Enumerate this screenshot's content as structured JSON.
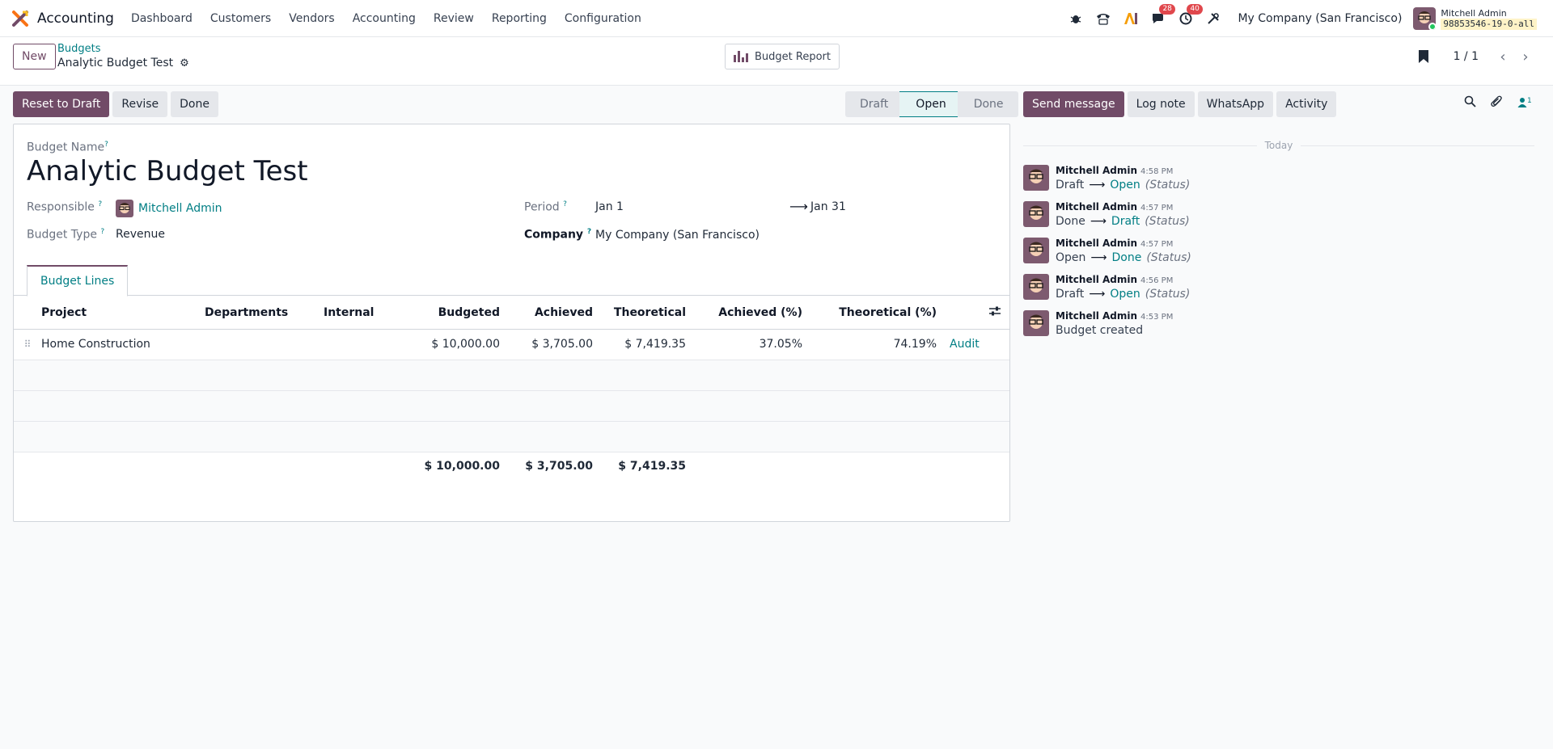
{
  "navbar": {
    "app_name": "Accounting",
    "menu": [
      "Dashboard",
      "Customers",
      "Vendors",
      "Accounting",
      "Review",
      "Reporting",
      "Configuration"
    ],
    "chat_badge": "28",
    "activity_badge": "40",
    "company": "My Company (San Francisco)",
    "user_name": "Mitchell Admin",
    "db_name": "98853546-19-0-all"
  },
  "control": {
    "new_label": "New",
    "breadcrumb_parent": "Budgets",
    "breadcrumb_current": "Analytic Budget Test",
    "report_label": "Budget Report",
    "pager_value": "1 / 1"
  },
  "statusbar": {
    "buttons": [
      "Reset to Draft",
      "Revise",
      "Done"
    ],
    "stages": [
      "Draft",
      "Open",
      "Done"
    ],
    "active_stage": "Open"
  },
  "form": {
    "budget_name_label": "Budget Name",
    "budget_name": "Analytic Budget Test",
    "responsible_label": "Responsible",
    "responsible": "Mitchell Admin",
    "budget_type_label": "Budget Type",
    "budget_type": "Revenue",
    "period_label": "Period",
    "period_from": "Jan 1",
    "period_to": "Jan 31",
    "company_label": "Company",
    "company": "My Company (San Francisco)",
    "tab_label": "Budget Lines"
  },
  "table": {
    "columns": [
      "Project",
      "Departments",
      "Internal",
      "Budgeted",
      "Achieved",
      "Theoretical",
      "Achieved (%)",
      "Theoretical (%)"
    ],
    "rows": [
      {
        "project": "Home Construction",
        "departments": "",
        "internal": "",
        "budgeted": "$ 10,000.00",
        "achieved": "$ 3,705.00",
        "theoretical": "$ 7,419.35",
        "achieved_pct": "37.05%",
        "theoretical_pct": "74.19%",
        "action": "Audit"
      }
    ],
    "totals": {
      "budgeted": "$ 10,000.00",
      "achieved": "$ 3,705.00",
      "theoretical": "$ 7,419.35"
    }
  },
  "chatter": {
    "buttons": [
      "Send message",
      "Log note",
      "WhatsApp",
      "Activity"
    ],
    "followers_count": "1",
    "date_separator": "Today",
    "messages": [
      {
        "author": "Mitchell Admin",
        "time": "4:58 PM",
        "old": "Draft",
        "new": "Open",
        "field": "(Status)"
      },
      {
        "author": "Mitchell Admin",
        "time": "4:57 PM",
        "old": "Done",
        "new": "Draft",
        "field": "(Status)"
      },
      {
        "author": "Mitchell Admin",
        "time": "4:57 PM",
        "old": "Open",
        "new": "Done",
        "field": "(Status)"
      },
      {
        "author": "Mitchell Admin",
        "time": "4:56 PM",
        "old": "Draft",
        "new": "Open",
        "field": "(Status)"
      },
      {
        "author": "Mitchell Admin",
        "time": "4:53 PM",
        "text": "Budget created"
      }
    ]
  },
  "colors": {
    "brand": "#714b67",
    "link": "#017e84",
    "badge": "#e0474c"
  }
}
